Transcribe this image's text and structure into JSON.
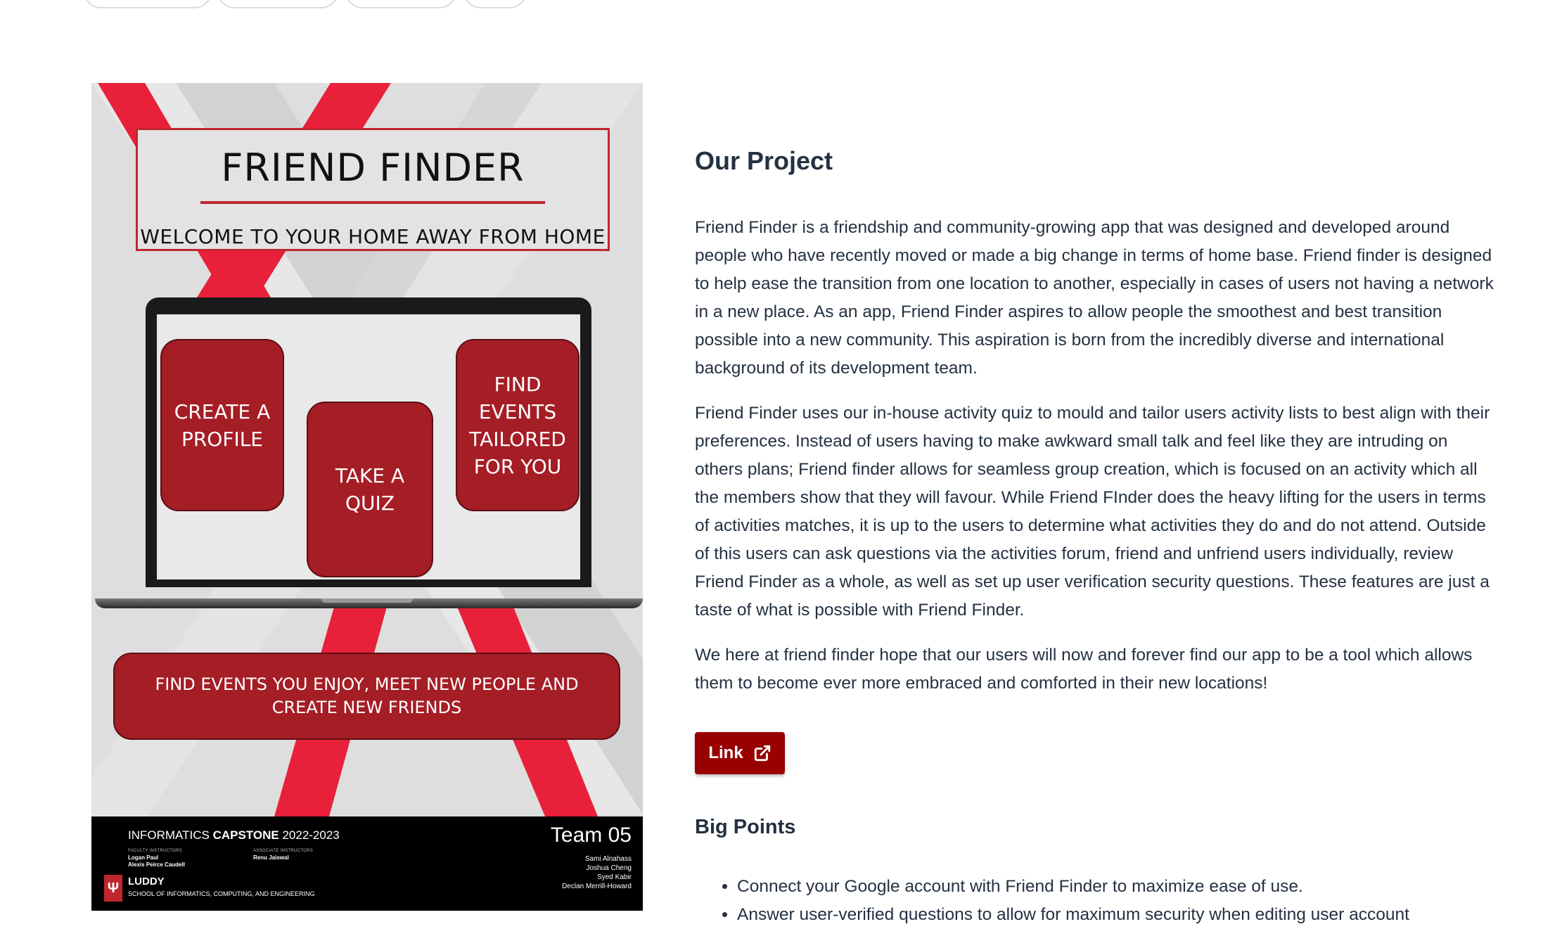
{
  "poster": {
    "title": "FRIEND FINDER",
    "subtitle": "WELCOME TO YOUR HOME AWAY FROM HOME",
    "cards": {
      "profile": "CREATE A PROFILE",
      "quiz": "TAKE A QUIZ",
      "events": "FIND EVENTS TAILORED FOR YOU"
    },
    "banner": "FIND EVENTS YOU ENJOY, MEET NEW PEOPLE AND CREATE NEW FRIENDS",
    "footer": {
      "capstone_prefix": "INFORMATICS ",
      "capstone_bold": "CAPSTONE",
      "capstone_year": " 2022-2023",
      "faculty_label": "FACULTY INSTRUCTORS",
      "faculty_names": "Logan Paul\nAlexis Peirce Caudell",
      "associate_label": "ASSOCIATE INSTRUCTORS",
      "associate_names": "Renu Jaiswal",
      "team": "Team 05",
      "members": "Sami Alnahass\nJoshua Cheng\nSyed Kabir\nDeclan Merrill-Howard",
      "logo_mark": "Ψ",
      "luddy": "LUDDY",
      "school": "SCHOOL OF INFORMATICS, COMPUTING, AND ENGINEERING"
    }
  },
  "project": {
    "heading": "Our Project",
    "paragraphs": [
      "Friend Finder is a friendship and community-growing app that was designed and developed around people who have recently moved or made a big change in terms of home base. Friend finder is designed to help ease the transition from one location to another, especially in cases of users not having a network in a new place. As an app, Friend Finder aspires to allow people the smoothest and best transition possible into a new community. This aspiration is born from the incredibly diverse and international background of its development team.",
      "Friend Finder uses our in-house activity quiz to mould and tailor users activity lists to best align with their preferences. Instead of users having to make awkward small talk and feel like they are intruding on others plans; Friend finder allows for seamless group creation, which is focused on an activity which all the members show that they will favour. While Friend FInder does the heavy lifting for the users in terms of activities matches, it is up to the users to determine what activities they do and do not attend. Outside of this users can ask questions via the activities forum, friend and unfriend users individually, review Friend Finder as a whole, as well as set up user verification security questions. These features are just a taste of what is possible with Friend Finder.",
      "We here at friend finder hope that our users will now and forever find our app to be a tool which allows them to become ever more embraced and comforted in their new locations!"
    ],
    "link_label": "Link",
    "link_icon": "external-link-icon",
    "points_heading": "Big Points",
    "points": [
      "Connect your Google account with Friend Finder to maximize ease of use.",
      "Answer user-verified questions to allow for maximum security when editing user account"
    ]
  },
  "colors": {
    "accent": "#990000",
    "poster_red": "#a51d25",
    "stripe_red": "#e8203a",
    "text": "#243142"
  }
}
